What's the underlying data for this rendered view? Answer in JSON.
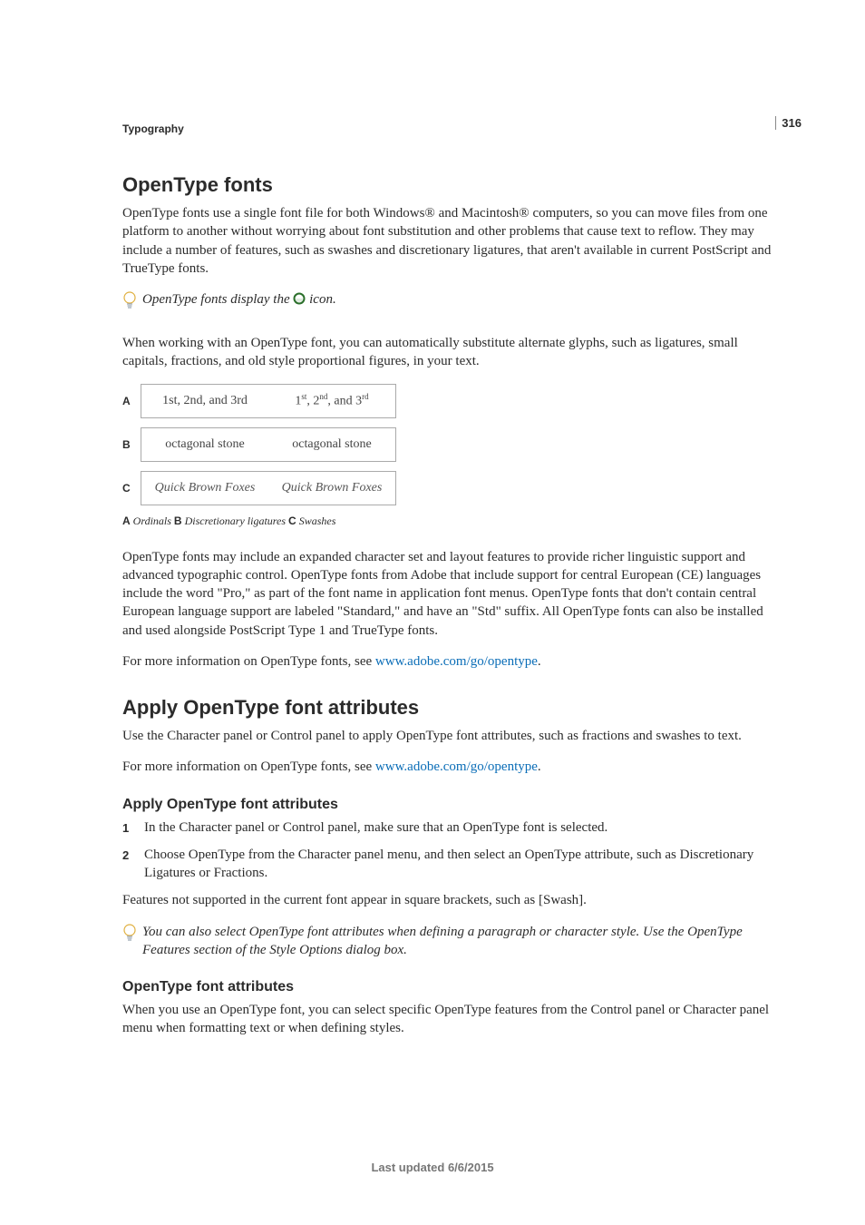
{
  "page_number": "316",
  "chapter_label": "Typography",
  "h1": "OpenType fonts",
  "p1": "OpenType fonts use a single font file for both Windows® and Macintosh® computers, so you can move files from one platform to another without worrying about font substitution and other problems that cause text to reflow. They may include a number of features, such as swashes and discretionary ligatures, that aren't available in current PostScript and TrueType fonts.",
  "tip1_prefix": "OpenType fonts display the ",
  "tip1_suffix": " icon.",
  "p2": "When working with an OpenType font, you can automatically substitute alternate glyphs, such as ligatures, small capitals, fractions, and old style proportional figures, in your text.",
  "figure": {
    "rows": [
      {
        "label": "A",
        "left": "1st, 2nd, and 3rd",
        "right_html": "1<span class='ord'>st</span>, 2<span class='ord'>nd</span>, and 3<span class='ord'>rd</span>"
      },
      {
        "label": "B",
        "left": "octagonal stone",
        "right": "octagonal stone"
      },
      {
        "label": "C",
        "left": "Quick Brown Foxes",
        "right": "Quick Brown Foxes"
      }
    ],
    "caption_a_label": "A",
    "caption_a": " Ordinals ",
    "caption_b_label": "B",
    "caption_b": " Discretionary ligatures ",
    "caption_c_label": "C",
    "caption_c": " Swashes"
  },
  "p3": "OpenType fonts may include an expanded character set and layout features to provide richer linguistic support and advanced typographic control. OpenType fonts from Adobe that include support for central European (CE) languages include the word \"Pro,\" as part of the font name in application font menus. OpenType fonts that don't contain central European language support are labeled \"Standard,\" and have an \"Std\" suffix. All OpenType fonts can also be installed and used alongside PostScript Type 1 and TrueType fonts.",
  "p4_prefix": "For more information on OpenType fonts, see ",
  "p4_link": "www.adobe.com/go/opentype",
  "p4_suffix": ".",
  "h2": "Apply OpenType font attributes",
  "p5": "Use the Character panel or Control panel to apply OpenType font attributes, such as fractions and swashes to text.",
  "p6_prefix": "For more information on OpenType fonts, see ",
  "p6_link": "www.adobe.com/go/opentype",
  "p6_suffix": ".",
  "h3a": "Apply OpenType font attributes",
  "steps": [
    "In the Character panel or Control panel, make sure that an OpenType font is selected.",
    "Choose OpenType from the Character panel menu, and then select an OpenType attribute, such as Discretionary Ligatures or Fractions."
  ],
  "p7": "Features not supported in the current font appear in square brackets, such as [Swash].",
  "tip2": "You can also select OpenType font attributes when defining a paragraph or character style. Use the OpenType Features section of the Style Options dialog box.",
  "h3b": "OpenType font attributes",
  "p8": "When you use an OpenType font, you can select specific OpenType features from the Control panel or Character panel menu when formatting text or when defining styles.",
  "footer": "Last updated 6/6/2015"
}
